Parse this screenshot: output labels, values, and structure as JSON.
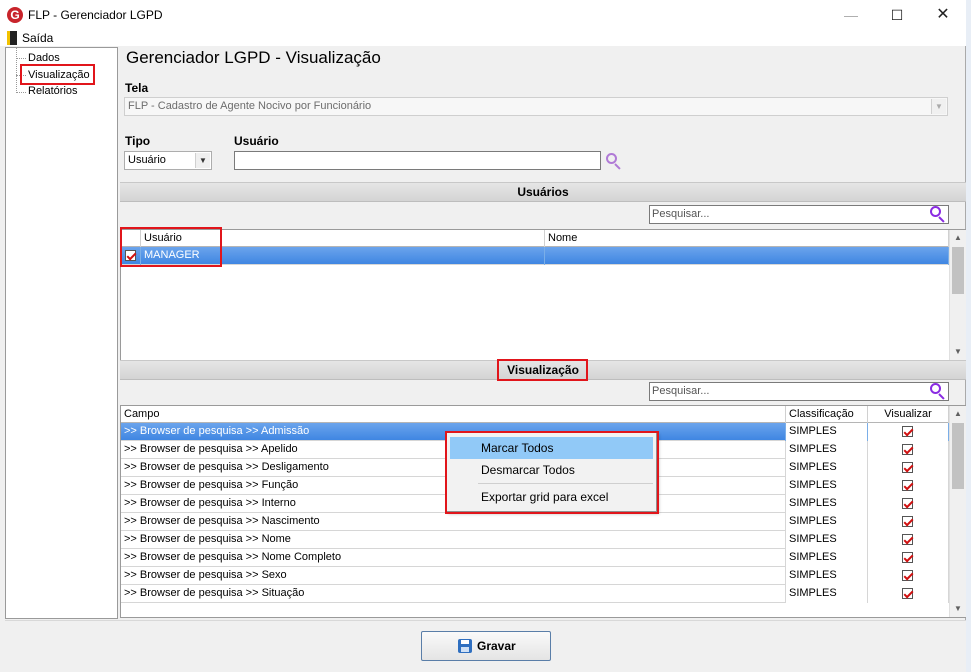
{
  "window": {
    "title": "FLP - Gerenciador LGPD",
    "minimize_glyph": "—",
    "maximize_glyph": "☐",
    "close_glyph": "✕"
  },
  "menu": {
    "exit_label": "Saída"
  },
  "sidebar": {
    "items": [
      {
        "label": "Dados"
      },
      {
        "label": "Visualização"
      },
      {
        "label": "Relatórios"
      }
    ]
  },
  "main": {
    "title": "Gerenciador LGPD - Visualização",
    "tela_label": "Tela",
    "tela_value": "FLP - Cadastro de Agente Nocivo por Funcionário",
    "tipo_label": "Tipo",
    "tipo_value": "Usuário",
    "usuario_label": "Usuário",
    "usuario_value": ""
  },
  "users_section": {
    "title": "Usuários",
    "search_placeholder": "Pesquisar...",
    "columns": [
      "Usuário",
      "Nome"
    ],
    "rows": [
      {
        "usuario": "MANAGER",
        "nome": "",
        "checked": true
      }
    ]
  },
  "view_section": {
    "title": "Visualização",
    "search_placeholder": "Pesquisar...",
    "columns": [
      "Campo",
      "Classificação",
      "Visualizar"
    ],
    "rows": [
      {
        "campo": ">> Browser de pesquisa >> Admissão",
        "classificacao": "SIMPLES",
        "visualizar": true
      },
      {
        "campo": ">> Browser de pesquisa >> Apelido",
        "classificacao": "SIMPLES",
        "visualizar": true
      },
      {
        "campo": ">> Browser de pesquisa >> Desligamento",
        "classificacao": "SIMPLES",
        "visualizar": true
      },
      {
        "campo": ">> Browser de pesquisa >> Função",
        "classificacao": "SIMPLES",
        "visualizar": true
      },
      {
        "campo": ">> Browser de pesquisa >> Interno",
        "classificacao": "SIMPLES",
        "visualizar": true
      },
      {
        "campo": ">> Browser de pesquisa >> Nascimento",
        "classificacao": "SIMPLES",
        "visualizar": true
      },
      {
        "campo": ">> Browser de pesquisa >> Nome",
        "classificacao": "SIMPLES",
        "visualizar": true
      },
      {
        "campo": ">> Browser de pesquisa >> Nome Completo",
        "classificacao": "SIMPLES",
        "visualizar": true
      },
      {
        "campo": ">> Browser de pesquisa >> Sexo",
        "classificacao": "SIMPLES",
        "visualizar": true
      },
      {
        "campo": ">> Browser de pesquisa >> Situação",
        "classificacao": "SIMPLES",
        "visualizar": true
      }
    ]
  },
  "context_menu": {
    "items": [
      {
        "label": "Marcar Todos"
      },
      {
        "label": "Desmarcar Todos"
      },
      {
        "label": "Exportar grid para excel"
      }
    ]
  },
  "footer": {
    "save_label": "Gravar"
  },
  "colors": {
    "accent_red": "#e1151b",
    "selection_blue": "#3f86e2",
    "search_icon": "#8a2be2"
  }
}
